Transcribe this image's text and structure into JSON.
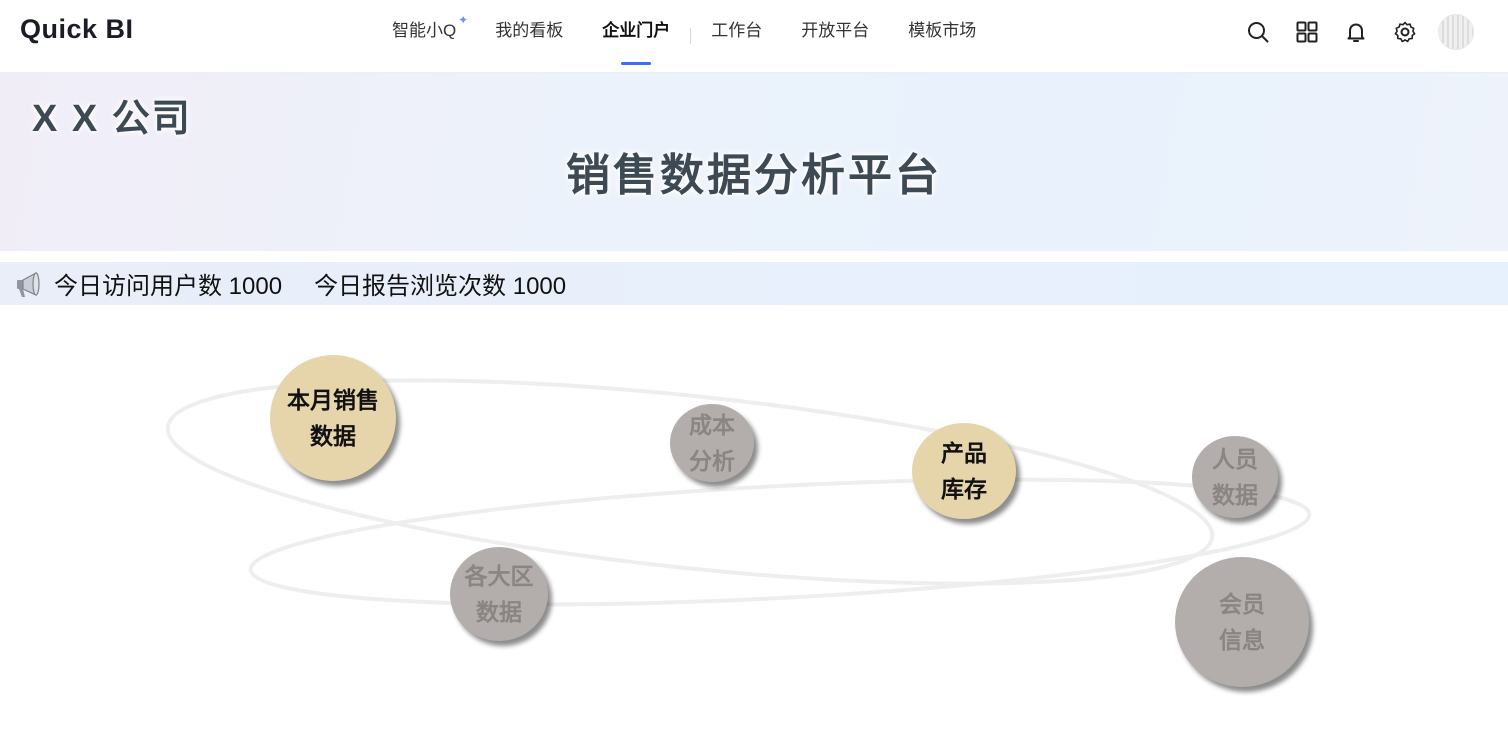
{
  "app": {
    "logo_text": "Quick BI"
  },
  "nav": {
    "items": [
      {
        "label": "智能小Q",
        "active": false
      },
      {
        "label": "我的看板",
        "active": false
      },
      {
        "label": "企业门户",
        "active": true
      },
      {
        "label": "工作台",
        "active": false
      },
      {
        "label": "开放平台",
        "active": false
      },
      {
        "label": "模板市场",
        "active": false
      }
    ]
  },
  "toolbar": {
    "icons": [
      "search-icon",
      "apps-grid-icon",
      "bell-icon",
      "gear-icon"
    ]
  },
  "banner": {
    "company": "X X 公司",
    "title": "销售数据分析平台"
  },
  "notice": {
    "icon": "megaphone-icon",
    "visits": "今日访问用户数 1000",
    "views": "今日报告浏览次数 1000"
  },
  "modules": [
    {
      "line1": "本月销售",
      "line2": "数据",
      "style": "gold"
    },
    {
      "line1": "成本",
      "line2": "分析",
      "style": "gray"
    },
    {
      "line1": "产品",
      "line2": "库存",
      "style": "gold"
    },
    {
      "line1": "人员",
      "line2": "数据",
      "style": "gray"
    },
    {
      "line1": "各大区",
      "line2": "数据",
      "style": "gray"
    },
    {
      "line1": "会员",
      "line2": "信息",
      "style": "gray"
    }
  ],
  "colors": {
    "accent": "#3a6ff5",
    "gold_bubble": "#e6d5aa",
    "gray_bubble": "#b3aeab",
    "title_text": "#3d4a56"
  }
}
